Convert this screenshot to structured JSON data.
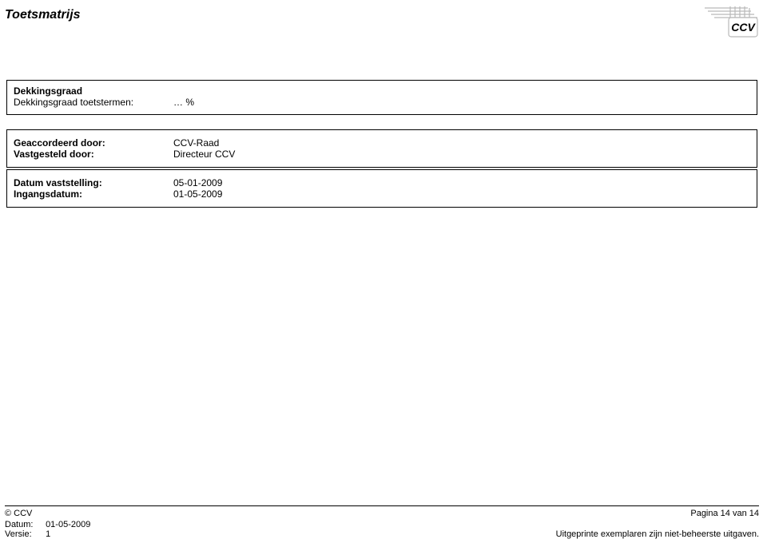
{
  "header": {
    "title": "Toetsmatrijs",
    "logo_name": "ccv-logo"
  },
  "dekkingsgraad": {
    "heading": "Dekkingsgraad",
    "row_label": "Dekkingsgraad toetstermen:",
    "row_value": "… %"
  },
  "approval": {
    "accorded_label": "Geaccordeerd door:",
    "accorded_value": "CCV-Raad",
    "vastgesteld_label": "Vastgesteld door:",
    "vastgesteld_value": "Directeur CCV"
  },
  "dates": {
    "vaststelling_label": "Datum vaststelling:",
    "vaststelling_value": "05-01-2009",
    "ingangs_label": "Ingangsdatum:",
    "ingangs_value": "01-05-2009"
  },
  "footer": {
    "copyright": "© CCV",
    "page_text": "Pagina 14 van 14",
    "datum_label": "Datum:",
    "datum_value": "01-05-2009",
    "versie_label": "Versie:",
    "versie_value": "1",
    "print_note": "Uitgeprinte exemplaren zijn niet-beheerste uitgaven."
  }
}
